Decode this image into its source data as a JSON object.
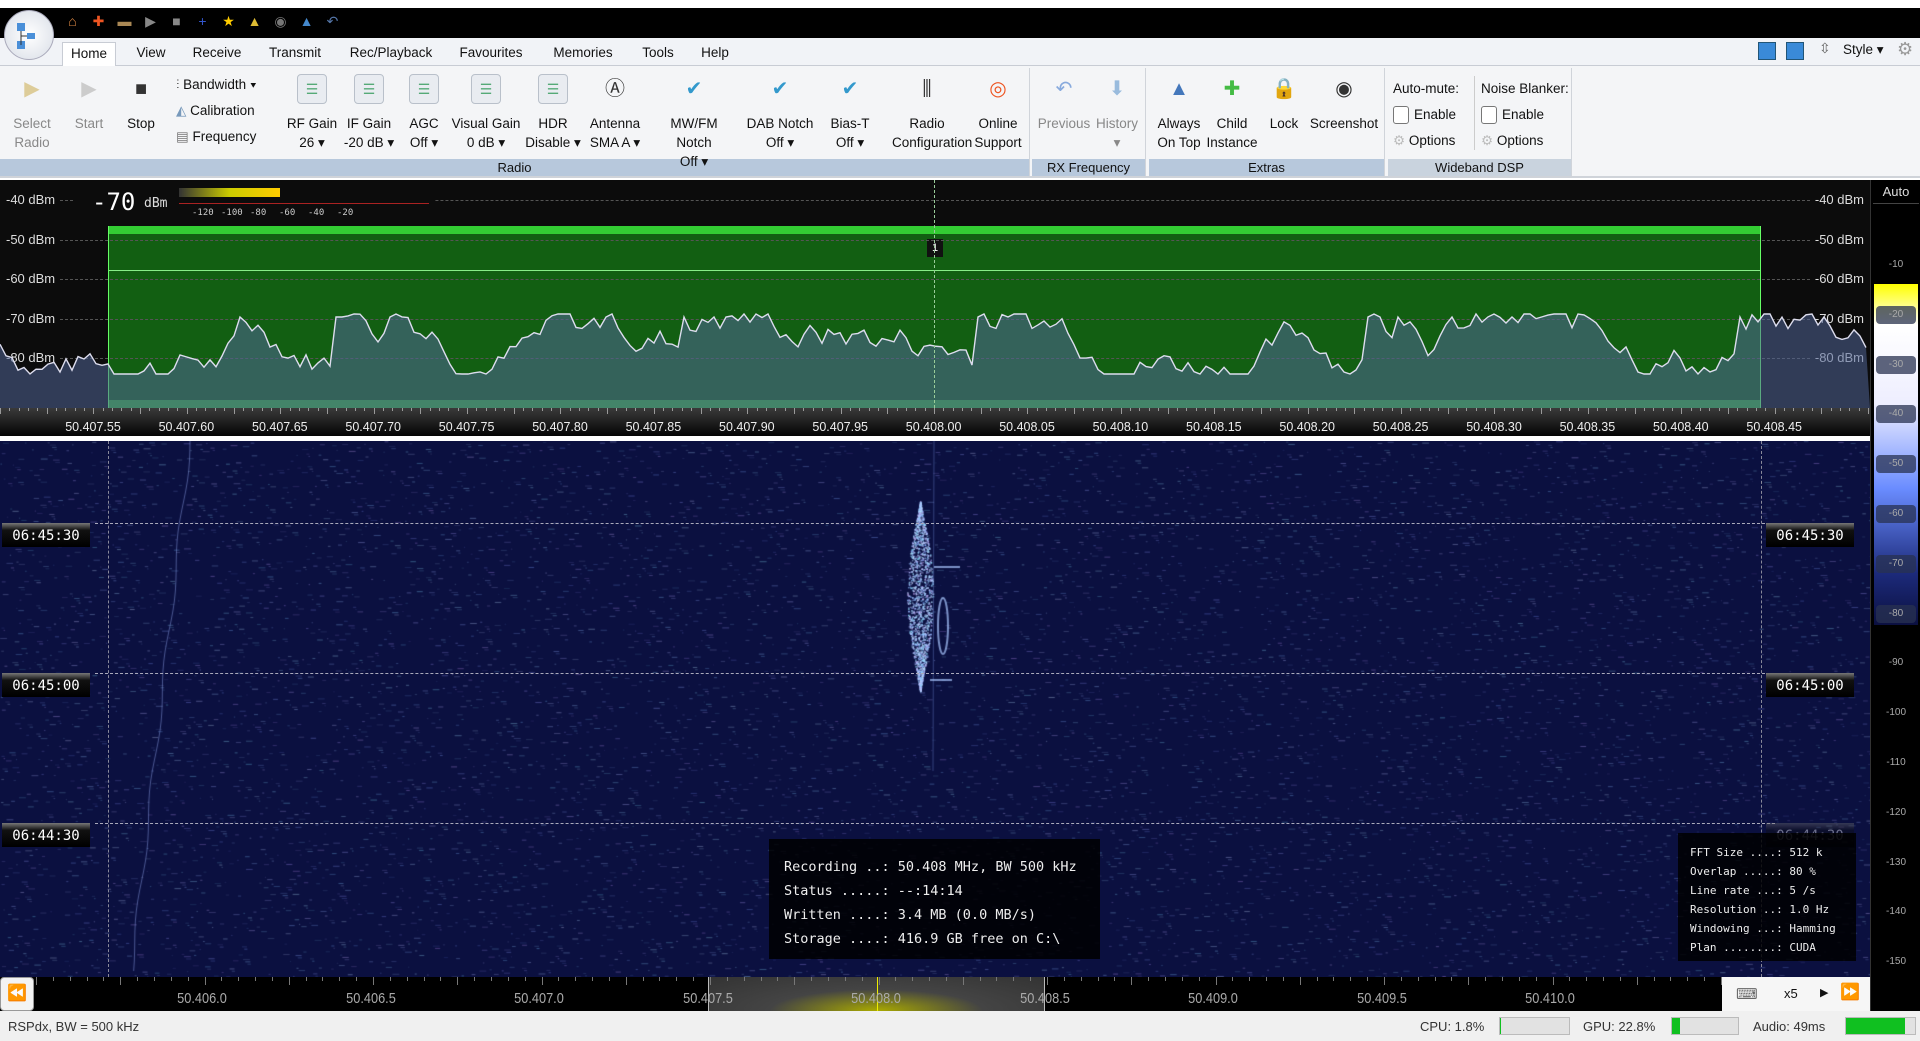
{
  "quick_access": [
    "home-icon",
    "lifebuoy-icon",
    "folder-icon",
    "play-icon",
    "stop-icon",
    "plus-icon",
    "star-icon",
    "lock-icon",
    "camera-icon",
    "pin-icon",
    "undo-icon"
  ],
  "menu": {
    "tabs": [
      "Home",
      "View",
      "Receive",
      "Transmit",
      "Rec/Playback",
      "Favourites",
      "Memories",
      "Tools",
      "Help"
    ],
    "selected": "Home",
    "style_label": "Style"
  },
  "ribbon": {
    "radio": {
      "label": "Radio",
      "select_radio": [
        "Select",
        "Radio"
      ],
      "start": "Start",
      "stop": "Stop",
      "bandwidth": "Bandwidth",
      "calibration": "Calibration",
      "frequency": "Frequency",
      "rf_gain": [
        "RF Gain",
        "26"
      ],
      "if_gain": [
        "IF Gain",
        "-20 dB"
      ],
      "agc": [
        "AGC",
        "Off"
      ],
      "visual_gain": [
        "Visual Gain",
        "0 dB"
      ],
      "hdr": [
        "HDR",
        "Disable"
      ],
      "antenna": [
        "Antenna",
        "SMA A"
      ],
      "mwfm_notch": [
        "MW/FM Notch",
        "Off"
      ],
      "dab_notch": [
        "DAB Notch",
        "Off"
      ],
      "bias_t": [
        "Bias-T",
        "Off"
      ],
      "radio_config": [
        "Radio",
        "Configuration"
      ],
      "online_support": [
        "Online",
        "Support"
      ]
    },
    "rx_frequency": {
      "label": "RX Frequency",
      "previous": "Previous",
      "history": "History"
    },
    "extras": {
      "label": "Extras",
      "always_on_top": [
        "Always",
        "On Top"
      ],
      "child_instance": [
        "Child",
        "Instance"
      ],
      "lock": "Lock",
      "screenshot": "Screenshot"
    },
    "wideband_dsp": {
      "label": "Wideband DSP",
      "auto_mute": "Auto-mute:",
      "noise_blanker": "Noise Blanker:",
      "enable": "Enable",
      "options": "Options"
    }
  },
  "spectrum": {
    "level_value": "-70",
    "level_unit": "dBm",
    "level_pct": 0.72,
    "meter_scale": [
      "-120",
      "-100",
      "-80",
      "-60",
      "-40",
      "-20"
    ],
    "db_labels": [
      "-40 dBm",
      "-50 dBm",
      "-60 dBm",
      "-70 dBm",
      "-80 dBm"
    ],
    "vfo_marker": "1",
    "freq_labels": [
      "50.407.55",
      "50.407.60",
      "50.407.65",
      "50.407.70",
      "50.407.75",
      "50.407.80",
      "50.407.85",
      "50.407.90",
      "50.407.95",
      "50.408.00",
      "50.408.05",
      "50.408.10",
      "50.408.15",
      "50.408.20",
      "50.408.25",
      "50.408.30",
      "50.408.35",
      "50.408.40",
      "50.408.45"
    ]
  },
  "waterfall": {
    "time_labels": [
      "06:45:30",
      "06:45:00",
      "06:44:30"
    ],
    "recording": [
      "Recording ..: 50.408 MHz, BW 500 kHz",
      "Status .....: --:14:14",
      "Written ....: 3.4 MB (0.0 MB/s)",
      "Storage ....: 416.9 GB free on C:\\"
    ],
    "fft_info": [
      "FFT Size ....: 512 k",
      "Overlap .....: 80 %",
      "Line rate ...: 5 /s",
      "Resolution ..: 1.0 Hz",
      "Windowing ...: Hamming",
      "Plan ........: CUDA"
    ]
  },
  "colorbar": {
    "auto": "Auto",
    "labels": [
      "-10",
      "-20",
      "-30",
      "-40",
      "-50",
      "-60",
      "-70",
      "-80",
      "-90",
      "-100",
      "-110",
      "-120",
      "-130",
      "-140",
      "-150"
    ]
  },
  "overview": {
    "freq_labels": [
      "50.406.0",
      "50.406.5",
      "50.407.0",
      "50.407.5",
      "50.408.0",
      "50.408.5",
      "50.409.0",
      "50.409.5",
      "50.410.0"
    ],
    "zoom": "x5"
  },
  "status": {
    "device": "RSPdx, BW = 500 kHz",
    "cpu": "CPU: 1.8%",
    "cpu_pct": 1.8,
    "gpu": "GPU: 22.8%",
    "gpu_pct": 22.8,
    "audio": "Audio: 49ms",
    "audio_pct": 85,
    "accent": "#10c020"
  }
}
